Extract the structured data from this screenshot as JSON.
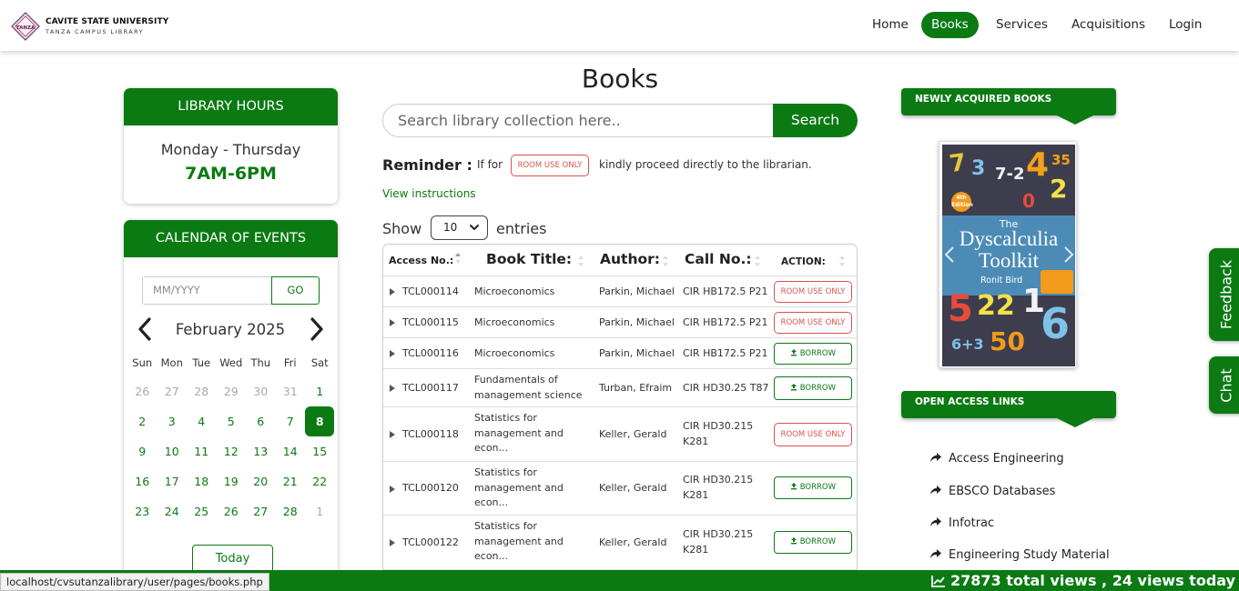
{
  "header": {
    "brand_line1": "CAVITE STATE UNIVERSITY",
    "brand_line2": "TANZA CAMPUS LIBRARY",
    "logo_text": "TANZA",
    "nav": [
      {
        "label": "Home"
      },
      {
        "label": "Books",
        "active": true
      },
      {
        "label": "Services"
      },
      {
        "label": "Acquisitions"
      },
      {
        "label": "Login"
      }
    ]
  },
  "library_hours": {
    "title": "LIBRARY HOURS",
    "days": "Monday - Thursday",
    "time": "7AM-6PM"
  },
  "calendar": {
    "title": "CALENDAR OF EVENTS",
    "month_placeholder": "MM/YYYY",
    "go_label": "GO",
    "month_label": "February 2025",
    "weekdays": [
      "Sun",
      "Mon",
      "Tue",
      "Wed",
      "Thu",
      "Fri",
      "Sat"
    ],
    "weeks": [
      [
        "26",
        "27",
        "28",
        "29",
        "30",
        "31",
        "1"
      ],
      [
        "2",
        "3",
        "4",
        "5",
        "6",
        "7",
        "8"
      ],
      [
        "9",
        "10",
        "11",
        "12",
        "13",
        "14",
        "15"
      ],
      [
        "16",
        "17",
        "18",
        "19",
        "20",
        "21",
        "22"
      ],
      [
        "23",
        "24",
        "25",
        "26",
        "27",
        "28",
        "1"
      ]
    ],
    "today": "8",
    "today_label": "Today"
  },
  "main": {
    "title": "Books",
    "search_placeholder": "Search library collection here..",
    "search_label": "Search",
    "reminder_label": "Reminder :",
    "reminder_if": "If for",
    "reminder_badge": "ROOM USE ONLY",
    "reminder_rest": "kindly proceed directly to the librarian.",
    "view_instructions": "View instructions",
    "show_label": "Show",
    "entries_value": "10",
    "entries_label": "entries"
  },
  "table": {
    "columns": [
      "Access No.:",
      "Book Title:",
      "Author:",
      "Call No.:",
      "ACTION:"
    ],
    "rows": [
      {
        "access": "TCL000114",
        "title": [
          "Microeconomics"
        ],
        "author": "Parkin, Michael",
        "call": [
          "CIR HB172.5 P21"
        ],
        "action": "ROOM USE ONLY",
        "action_type": "room"
      },
      {
        "access": "TCL000115",
        "title": [
          "Microeconomics"
        ],
        "author": "Parkin, Michael",
        "call": [
          "CIR HB172.5 P21"
        ],
        "action": "ROOM USE ONLY",
        "action_type": "room"
      },
      {
        "access": "TCL000116",
        "title": [
          "Microeconomics"
        ],
        "author": "Parkin, Michael",
        "call": [
          "CIR HB172.5 P21"
        ],
        "action": "BORROW",
        "action_type": "borrow"
      },
      {
        "access": "TCL000117",
        "title": [
          "Fundamentals of",
          "management science"
        ],
        "author": "Turban, Efraim",
        "call": [
          "CIR HD30.25 T87"
        ],
        "action": "BORROW",
        "action_type": "borrow"
      },
      {
        "access": "TCL000118",
        "title": [
          "Statistics for",
          "management and",
          "econ..."
        ],
        "author": "Keller, Gerald",
        "call": [
          "CIR HD30.215",
          "K281"
        ],
        "action": "ROOM USE ONLY",
        "action_type": "room"
      },
      {
        "access": "TCL000120",
        "title": [
          "Statistics for",
          "management and",
          "econ..."
        ],
        "author": "Keller, Gerald",
        "call": [
          "CIR HD30.215",
          "K281"
        ],
        "action": "BORROW",
        "action_type": "borrow"
      },
      {
        "access": "TCL000122",
        "title": [
          "Statistics for",
          "management and",
          "econ..."
        ],
        "author": "Keller, Gerald",
        "call": [
          "CIR HD30.215",
          "K281"
        ],
        "action": "BORROW",
        "action_type": "borrow"
      }
    ]
  },
  "newly_acquired": {
    "title": "NEWLY ACQUIRED BOOKS",
    "book": {
      "edition": "4th Edition",
      "the": "The",
      "title_line1": "Dyscalculia",
      "title_line2": "Toolkit",
      "author": "Ronit Bird"
    }
  },
  "open_access": {
    "title": "OPEN ACCESS LINKS",
    "links": [
      {
        "label": "Access Engineering"
      },
      {
        "label": "EBSCO Databases"
      },
      {
        "label": "Infotrac"
      },
      {
        "label": "Engineering Study Material"
      }
    ]
  },
  "side_tabs": {
    "feedback": "Feedback",
    "chat": "Chat"
  },
  "footer": {
    "views": "27873 total views , 24 views today"
  },
  "status_bar": {
    "url": "localhost/cvsutanzalibrary/user/pages/books.php"
  },
  "colors": {
    "brand_green": "#0b7a13",
    "room_red": "#d9534f"
  }
}
